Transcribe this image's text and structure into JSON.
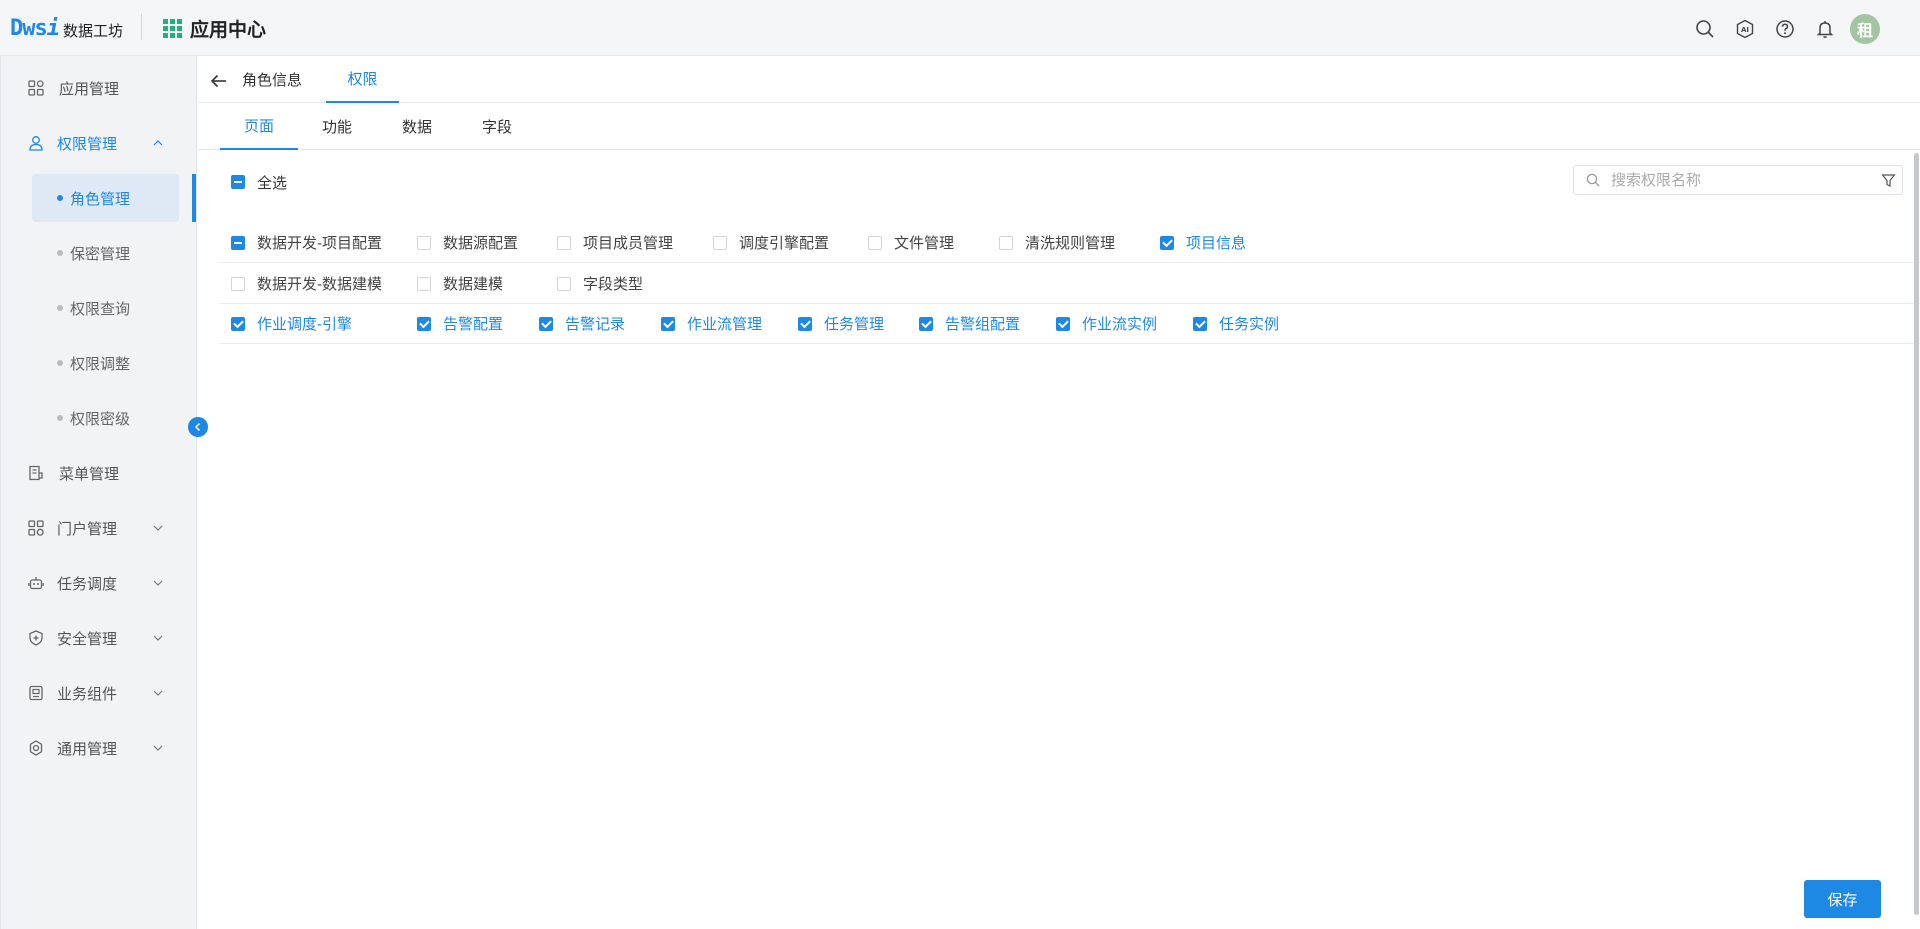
{
  "header": {
    "logo_mark": "Dws",
    "logo_i": "i",
    "logo_text": "数据工坊",
    "app_center": "应用中心",
    "avatar_text": "租",
    "icons": [
      "search-icon",
      "ai-icon",
      "help-icon",
      "bell-icon"
    ],
    "accent_color": "#1e88e5"
  },
  "sidebar": {
    "items": [
      {
        "label": "应用管理",
        "icon": "apps-icon"
      },
      {
        "label": "权限管理",
        "icon": "user-lock-icon",
        "expanded": true
      },
      {
        "label": "菜单管理",
        "icon": "menu-doc-icon"
      },
      {
        "label": "门户管理",
        "icon": "portal-icon"
      },
      {
        "label": "任务调度",
        "icon": "robot-icon"
      },
      {
        "label": "安全管理",
        "icon": "shield-icon"
      },
      {
        "label": "业务组件",
        "icon": "component-icon"
      },
      {
        "label": "通用管理",
        "icon": "settings-icon"
      }
    ],
    "sub_items": [
      {
        "label": "角色管理",
        "active": true
      },
      {
        "label": "保密管理"
      },
      {
        "label": "权限查询"
      },
      {
        "label": "权限调整"
      },
      {
        "label": "权限密级"
      }
    ]
  },
  "tabs": {
    "top": [
      "角色信息",
      "权限"
    ],
    "top_active": "权限",
    "sub": [
      "页面",
      "功能",
      "数据",
      "字段"
    ],
    "sub_active": "页面"
  },
  "select_all_label": "全选",
  "search": {
    "placeholder": "搜索权限名称",
    "value": ""
  },
  "permission_rows": [
    {
      "group": {
        "label": "数据开发-项目配置",
        "state": "indeterminate"
      },
      "items": [
        {
          "label": "数据源配置",
          "checked": false
        },
        {
          "label": "项目成员管理",
          "checked": false
        },
        {
          "label": "调度引擎配置",
          "checked": false
        },
        {
          "label": "文件管理",
          "checked": false
        },
        {
          "label": "清洗规则管理",
          "checked": false
        },
        {
          "label": "项目信息",
          "checked": true
        }
      ]
    },
    {
      "group": {
        "label": "数据开发-数据建模",
        "state": "unchecked"
      },
      "items": [
        {
          "label": "数据建模",
          "checked": false
        },
        {
          "label": "字段类型",
          "checked": false
        }
      ]
    },
    {
      "group": {
        "label": "作业调度-引擎",
        "state": "checked"
      },
      "items": [
        {
          "label": "告警配置",
          "checked": true
        },
        {
          "label": "告警记录",
          "checked": true
        },
        {
          "label": "作业流管理",
          "checked": true
        },
        {
          "label": "任务管理",
          "checked": true
        },
        {
          "label": "告警组配置",
          "checked": true
        },
        {
          "label": "作业流实例",
          "checked": true
        },
        {
          "label": "任务实例",
          "checked": true
        }
      ]
    }
  ],
  "save_label": "保存"
}
